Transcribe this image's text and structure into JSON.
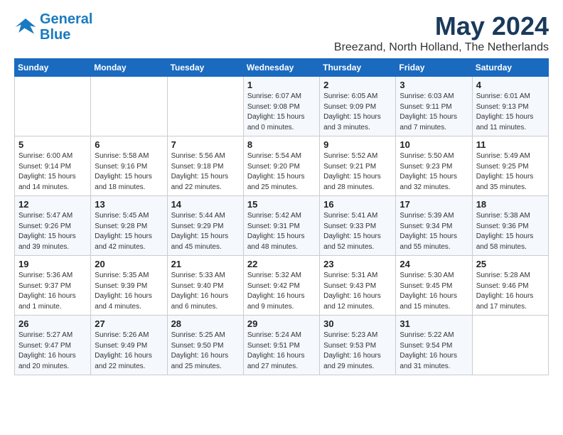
{
  "header": {
    "logo_line1": "General",
    "logo_line2": "Blue",
    "month": "May 2024",
    "location": "Breezand, North Holland, The Netherlands"
  },
  "weekdays": [
    "Sunday",
    "Monday",
    "Tuesday",
    "Wednesday",
    "Thursday",
    "Friday",
    "Saturday"
  ],
  "weeks": [
    [
      {
        "day": "",
        "sunrise": "",
        "sunset": "",
        "daylight": ""
      },
      {
        "day": "",
        "sunrise": "",
        "sunset": "",
        "daylight": ""
      },
      {
        "day": "",
        "sunrise": "",
        "sunset": "",
        "daylight": ""
      },
      {
        "day": "1",
        "sunrise": "Sunrise: 6:07 AM",
        "sunset": "Sunset: 9:08 PM",
        "daylight": "Daylight: 15 hours and 0 minutes."
      },
      {
        "day": "2",
        "sunrise": "Sunrise: 6:05 AM",
        "sunset": "Sunset: 9:09 PM",
        "daylight": "Daylight: 15 hours and 3 minutes."
      },
      {
        "day": "3",
        "sunrise": "Sunrise: 6:03 AM",
        "sunset": "Sunset: 9:11 PM",
        "daylight": "Daylight: 15 hours and 7 minutes."
      },
      {
        "day": "4",
        "sunrise": "Sunrise: 6:01 AM",
        "sunset": "Sunset: 9:13 PM",
        "daylight": "Daylight: 15 hours and 11 minutes."
      }
    ],
    [
      {
        "day": "5",
        "sunrise": "Sunrise: 6:00 AM",
        "sunset": "Sunset: 9:14 PM",
        "daylight": "Daylight: 15 hours and 14 minutes."
      },
      {
        "day": "6",
        "sunrise": "Sunrise: 5:58 AM",
        "sunset": "Sunset: 9:16 PM",
        "daylight": "Daylight: 15 hours and 18 minutes."
      },
      {
        "day": "7",
        "sunrise": "Sunrise: 5:56 AM",
        "sunset": "Sunset: 9:18 PM",
        "daylight": "Daylight: 15 hours and 22 minutes."
      },
      {
        "day": "8",
        "sunrise": "Sunrise: 5:54 AM",
        "sunset": "Sunset: 9:20 PM",
        "daylight": "Daylight: 15 hours and 25 minutes."
      },
      {
        "day": "9",
        "sunrise": "Sunrise: 5:52 AM",
        "sunset": "Sunset: 9:21 PM",
        "daylight": "Daylight: 15 hours and 28 minutes."
      },
      {
        "day": "10",
        "sunrise": "Sunrise: 5:50 AM",
        "sunset": "Sunset: 9:23 PM",
        "daylight": "Daylight: 15 hours and 32 minutes."
      },
      {
        "day": "11",
        "sunrise": "Sunrise: 5:49 AM",
        "sunset": "Sunset: 9:25 PM",
        "daylight": "Daylight: 15 hours and 35 minutes."
      }
    ],
    [
      {
        "day": "12",
        "sunrise": "Sunrise: 5:47 AM",
        "sunset": "Sunset: 9:26 PM",
        "daylight": "Daylight: 15 hours and 39 minutes."
      },
      {
        "day": "13",
        "sunrise": "Sunrise: 5:45 AM",
        "sunset": "Sunset: 9:28 PM",
        "daylight": "Daylight: 15 hours and 42 minutes."
      },
      {
        "day": "14",
        "sunrise": "Sunrise: 5:44 AM",
        "sunset": "Sunset: 9:29 PM",
        "daylight": "Daylight: 15 hours and 45 minutes."
      },
      {
        "day": "15",
        "sunrise": "Sunrise: 5:42 AM",
        "sunset": "Sunset: 9:31 PM",
        "daylight": "Daylight: 15 hours and 48 minutes."
      },
      {
        "day": "16",
        "sunrise": "Sunrise: 5:41 AM",
        "sunset": "Sunset: 9:33 PM",
        "daylight": "Daylight: 15 hours and 52 minutes."
      },
      {
        "day": "17",
        "sunrise": "Sunrise: 5:39 AM",
        "sunset": "Sunset: 9:34 PM",
        "daylight": "Daylight: 15 hours and 55 minutes."
      },
      {
        "day": "18",
        "sunrise": "Sunrise: 5:38 AM",
        "sunset": "Sunset: 9:36 PM",
        "daylight": "Daylight: 15 hours and 58 minutes."
      }
    ],
    [
      {
        "day": "19",
        "sunrise": "Sunrise: 5:36 AM",
        "sunset": "Sunset: 9:37 PM",
        "daylight": "Daylight: 16 hours and 1 minute."
      },
      {
        "day": "20",
        "sunrise": "Sunrise: 5:35 AM",
        "sunset": "Sunset: 9:39 PM",
        "daylight": "Daylight: 16 hours and 4 minutes."
      },
      {
        "day": "21",
        "sunrise": "Sunrise: 5:33 AM",
        "sunset": "Sunset: 9:40 PM",
        "daylight": "Daylight: 16 hours and 6 minutes."
      },
      {
        "day": "22",
        "sunrise": "Sunrise: 5:32 AM",
        "sunset": "Sunset: 9:42 PM",
        "daylight": "Daylight: 16 hours and 9 minutes."
      },
      {
        "day": "23",
        "sunrise": "Sunrise: 5:31 AM",
        "sunset": "Sunset: 9:43 PM",
        "daylight": "Daylight: 16 hours and 12 minutes."
      },
      {
        "day": "24",
        "sunrise": "Sunrise: 5:30 AM",
        "sunset": "Sunset: 9:45 PM",
        "daylight": "Daylight: 16 hours and 15 minutes."
      },
      {
        "day": "25",
        "sunrise": "Sunrise: 5:28 AM",
        "sunset": "Sunset: 9:46 PM",
        "daylight": "Daylight: 16 hours and 17 minutes."
      }
    ],
    [
      {
        "day": "26",
        "sunrise": "Sunrise: 5:27 AM",
        "sunset": "Sunset: 9:47 PM",
        "daylight": "Daylight: 16 hours and 20 minutes."
      },
      {
        "day": "27",
        "sunrise": "Sunrise: 5:26 AM",
        "sunset": "Sunset: 9:49 PM",
        "daylight": "Daylight: 16 hours and 22 minutes."
      },
      {
        "day": "28",
        "sunrise": "Sunrise: 5:25 AM",
        "sunset": "Sunset: 9:50 PM",
        "daylight": "Daylight: 16 hours and 25 minutes."
      },
      {
        "day": "29",
        "sunrise": "Sunrise: 5:24 AM",
        "sunset": "Sunset: 9:51 PM",
        "daylight": "Daylight: 16 hours and 27 minutes."
      },
      {
        "day": "30",
        "sunrise": "Sunrise: 5:23 AM",
        "sunset": "Sunset: 9:53 PM",
        "daylight": "Daylight: 16 hours and 29 minutes."
      },
      {
        "day": "31",
        "sunrise": "Sunrise: 5:22 AM",
        "sunset": "Sunset: 9:54 PM",
        "daylight": "Daylight: 16 hours and 31 minutes."
      },
      {
        "day": "",
        "sunrise": "",
        "sunset": "",
        "daylight": ""
      }
    ]
  ]
}
